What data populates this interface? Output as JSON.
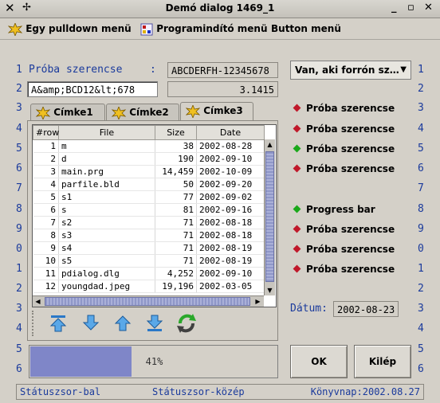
{
  "window": {
    "title": "Demó dialog 1469_1"
  },
  "menu": [
    "Egy pulldown menü",
    "Programindító menü",
    "Button menü"
  ],
  "left_ruler": [
    "1",
    "2",
    "3",
    "4",
    "5",
    "6",
    "7",
    "8",
    "9",
    "0",
    "1",
    "2",
    "3",
    "4",
    "5",
    "6"
  ],
  "right_ruler": [
    "1",
    "2",
    "3",
    "4",
    "5",
    "6",
    "7",
    "8",
    "9",
    "0",
    "1",
    "2",
    "3",
    "4",
    "5",
    "6"
  ],
  "form": {
    "label1": "Próba szerencse",
    "label1_colon": ":",
    "field1_value": "ABCDERFH-12345678",
    "field2_value": "A&amp;BCD12&lt;678",
    "field3_value": "3.1415",
    "combo_value": "Van, aki forrón sz…"
  },
  "tabs": [
    {
      "label": "Címke1",
      "active": false
    },
    {
      "label": "Címke2",
      "active": false
    },
    {
      "label": "Címke3",
      "active": true
    }
  ],
  "grid": {
    "columns": [
      "#row",
      "File",
      "Size",
      "Date"
    ],
    "rows": [
      [
        "1",
        "m",
        "38",
        "2002-08-28"
      ],
      [
        "2",
        "d",
        "190",
        "2002-09-10"
      ],
      [
        "3",
        "main.prg",
        "14,459",
        "2002-10-09"
      ],
      [
        "4",
        "parfile.bld",
        "50",
        "2002-09-20"
      ],
      [
        "5",
        "s1",
        "77",
        "2002-09-02"
      ],
      [
        "6",
        "s",
        "81",
        "2002-09-16"
      ],
      [
        "7",
        "s2",
        "71",
        "2002-08-18"
      ],
      [
        "8",
        "s3",
        "71",
        "2002-08-18"
      ],
      [
        "9",
        "s4",
        "71",
        "2002-08-19"
      ],
      [
        "10",
        "s5",
        "71",
        "2002-08-19"
      ],
      [
        "11",
        "pdialog.dlg",
        "4,252",
        "2002-09-10"
      ],
      [
        "12",
        "youngdad.jpeg",
        "19,196",
        "2002-03-05"
      ]
    ]
  },
  "toolbar_icons": [
    "arrow-top-icon",
    "arrow-down-icon",
    "arrow-up-icon",
    "arrow-bottom-icon",
    "refresh-icon"
  ],
  "radios": [
    {
      "label": "Próba szerencse",
      "color": "#c0182a"
    },
    {
      "label": "Próba szerencse",
      "color": "#c0182a"
    },
    {
      "label": "Próba szerencse",
      "color": "#1aa81a"
    },
    {
      "label": "Próba szerencse",
      "color": "#c0182a"
    },
    {
      "label": "Progress bar",
      "color": "#1aa81a"
    },
    {
      "label": "Próba szerencse",
      "color": "#c0182a"
    },
    {
      "label": "Próba szerencse",
      "color": "#c0182a"
    },
    {
      "label": "Próba szerencse",
      "color": "#c0182a"
    }
  ],
  "date": {
    "label": "Dátum:",
    "value": "2002-08-23"
  },
  "progress": {
    "value": 0.41,
    "label": "41%",
    "color": "#7f86c8"
  },
  "buttons": {
    "ok": "OK",
    "exit": "Kilép"
  },
  "status": {
    "left": "Státuszsor-bal",
    "center": "Státuszsor-közép",
    "right": "Könyvnap:2002.08.27"
  }
}
